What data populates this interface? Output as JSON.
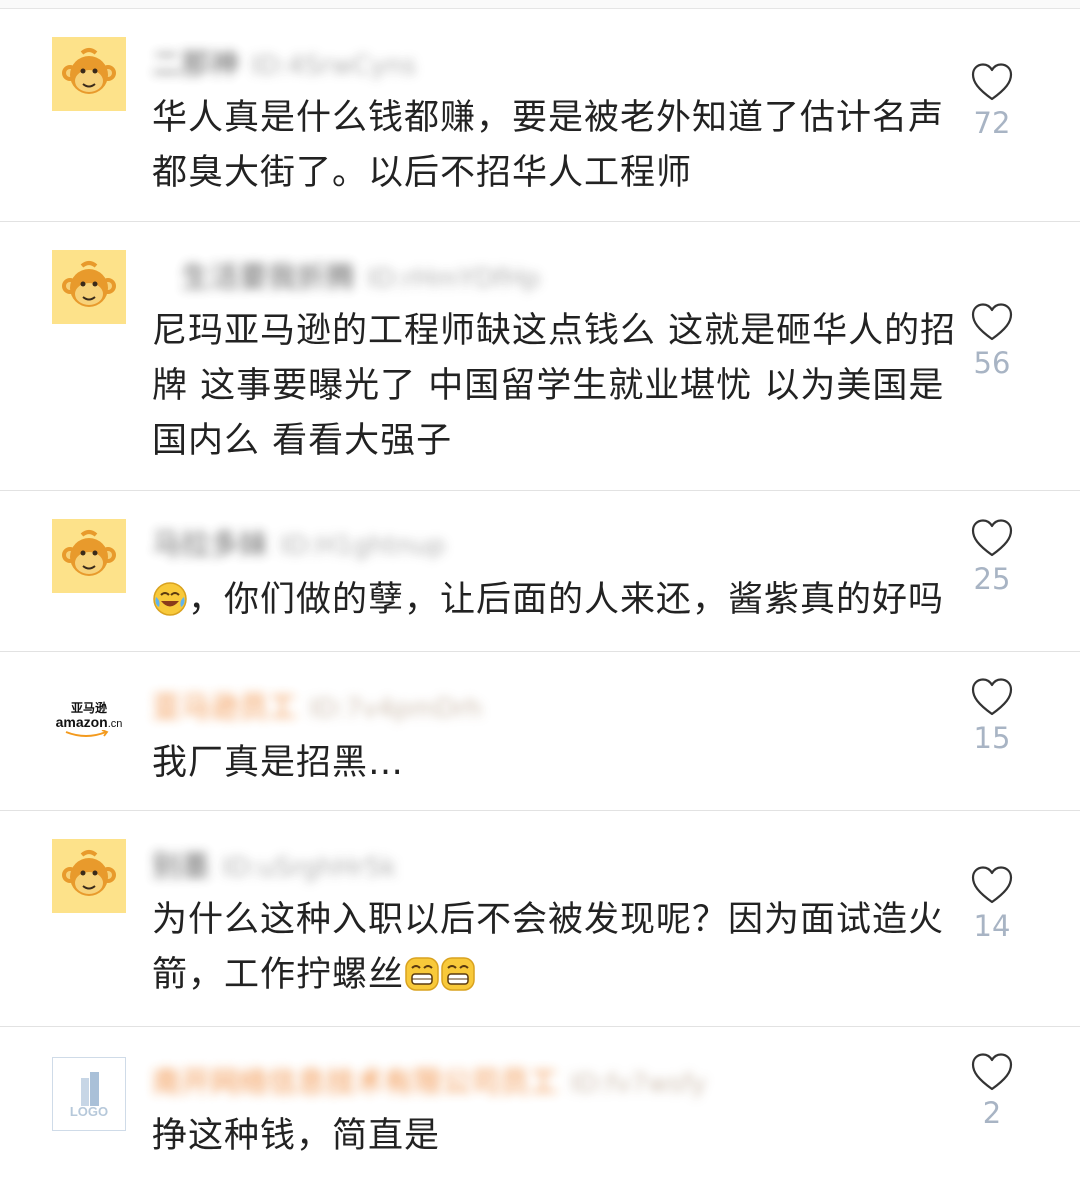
{
  "comments": [
    {
      "avatar": "monkey-avatar",
      "username": "二那神",
      "user_id": "ID:4SrwCyns",
      "text": "华人真是什么钱都赚，要是被老外知道了估计名声都臭大街了。以后不招华人工程师",
      "likes": "72"
    },
    {
      "avatar": "monkey-avatar",
      "username": "　生活要我折腾",
      "user_id": "ID:rHmYDfHp",
      "text": "尼玛亚马逊的工程师缺这点钱么 这就是砸华人的招牌 这事要曝光了 中国留学生就业堪忧 以为美国是国内么  看看大强子",
      "likes": "56"
    },
    {
      "avatar": "monkey-avatar",
      "username": "马拉多妹",
      "user_id": "ID:H1ghtnup",
      "emoji_prefix": "tears-of-joy-emoji",
      "text": "，你们做的孽，让后面的人来还，酱紫真的好吗",
      "likes": "25"
    },
    {
      "avatar": "amazon-logo",
      "avatar_text": {
        "top": "亚马逊",
        "bottom": "amazon",
        "suffix": ".cn"
      },
      "username": "亚马逊员工",
      "user_id": "ID:7v4pmDrh",
      "text": "我厂真是招黑…",
      "likes": "15"
    },
    {
      "avatar": "monkey-avatar",
      "username": "别墨",
      "user_id": "ID:uSrghHr5k",
      "text": "为什么这种入职以后不会被发现呢？因为面试造火箭，工作拧螺丝",
      "emoji_suffix": [
        "grin-emoji",
        "grin-emoji"
      ],
      "likes": "14"
    },
    {
      "avatar": "company-logo-placeholder",
      "avatar_text": {
        "label": "LOGO"
      },
      "username": "南开网络信息技术有限公司员工",
      "user_id": "ID:fv7wsfy",
      "text": "挣这种钱，简直是",
      "likes": "2"
    }
  ],
  "colors": {
    "like_count": "#a8b4c4",
    "monkey_bg": "#fde28a",
    "divider": "#e2e2e2",
    "orange_name": "#f08a3a"
  }
}
